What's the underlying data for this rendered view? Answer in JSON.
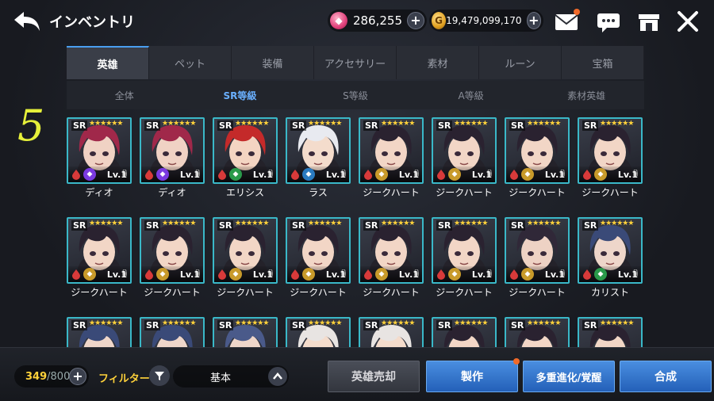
{
  "header": {
    "title": "インベントリ",
    "gems": "286,255",
    "gold": "19,479,099,170",
    "gold_symbol": "G"
  },
  "main_tabs": [
    {
      "label": "英雄",
      "active": true
    },
    {
      "label": "ペット",
      "active": false
    },
    {
      "label": "装備",
      "active": false
    },
    {
      "label": "アクセサリー",
      "active": false
    },
    {
      "label": "素材",
      "active": false
    },
    {
      "label": "ルーン",
      "active": false
    },
    {
      "label": "宝箱",
      "active": false
    }
  ],
  "sub_tabs": [
    {
      "label": "全体",
      "active": false
    },
    {
      "label": "SR等級",
      "active": true
    },
    {
      "label": "S等級",
      "active": false
    },
    {
      "label": "A等級",
      "active": false
    },
    {
      "label": "素材英雄",
      "active": false
    }
  ],
  "hand_mark": "5",
  "cards": [
    {
      "rank": "SR",
      "stars": "★★★★★★",
      "level": "Lv.1",
      "name": "ディオ",
      "hair": "#a0284a",
      "skin": "#f0d2c4",
      "class_color": "#7a3ae0",
      "class_icon": "purple-class-icon"
    },
    {
      "rank": "SR",
      "stars": "★★★★★★",
      "level": "Lv.1",
      "name": "ディオ",
      "hair": "#a0284a",
      "skin": "#f0d2c4",
      "class_color": "#7a3ae0",
      "class_icon": "purple-class-icon"
    },
    {
      "rank": "SR",
      "stars": "★★★★★★",
      "level": "Lv.1",
      "name": "エリシス",
      "hair": "#c42a2a",
      "skin": "#f4d4c2",
      "class_color": "#2a9a4a",
      "class_icon": "green-class-icon"
    },
    {
      "rank": "SR",
      "stars": "★★★★★★",
      "level": "Lv.1",
      "name": "ラス",
      "hair": "#e8eaf0",
      "skin": "#f4dccc",
      "class_color": "#2a7ac0",
      "class_icon": "blue-class-icon"
    },
    {
      "rank": "SR",
      "stars": "★★★★★★",
      "level": "Lv.1",
      "name": "ジークハート",
      "hair": "#2a2230",
      "skin": "#f2d6c6",
      "class_color": "#c89a2a",
      "class_icon": "gold-class-icon"
    },
    {
      "rank": "SR",
      "stars": "★★★★★★",
      "level": "Lv.1",
      "name": "ジークハート",
      "hair": "#2a2230",
      "skin": "#f2d6c6",
      "class_color": "#c89a2a",
      "class_icon": "gold-class-icon"
    },
    {
      "rank": "SR",
      "stars": "★★★★★★",
      "level": "Lv.1",
      "name": "ジークハート",
      "hair": "#2a2230",
      "skin": "#f2d6c6",
      "class_color": "#c89a2a",
      "class_icon": "gold-class-icon"
    },
    {
      "rank": "SR",
      "stars": "★★★★★★",
      "level": "Lv.1",
      "name": "ジークハート",
      "hair": "#2a2230",
      "skin": "#f2d6c6",
      "class_color": "#c89a2a",
      "class_icon": "gold-class-icon"
    },
    {
      "rank": "SR",
      "stars": "★★★★★★",
      "level": "Lv.1",
      "name": "ジークハート",
      "hair": "#2a2230",
      "skin": "#f2d6c6",
      "class_color": "#c89a2a",
      "class_icon": "gold-class-icon"
    },
    {
      "rank": "SR",
      "stars": "★★★★★★",
      "level": "Lv.1",
      "name": "ジークハート",
      "hair": "#2a2230",
      "skin": "#f2d6c6",
      "class_color": "#c89a2a",
      "class_icon": "gold-class-icon"
    },
    {
      "rank": "SR",
      "stars": "★★★★★★",
      "level": "Lv.1",
      "name": "ジークハート",
      "hair": "#2a2230",
      "skin": "#f2d6c6",
      "class_color": "#c89a2a",
      "class_icon": "gold-class-icon"
    },
    {
      "rank": "SR",
      "stars": "★★★★★★",
      "level": "Lv.1",
      "name": "ジークハート",
      "hair": "#2a2230",
      "skin": "#f2d6c6",
      "class_color": "#c89a2a",
      "class_icon": "gold-class-icon"
    },
    {
      "rank": "SR",
      "stars": "★★★★★★",
      "level": "Lv.1",
      "name": "ジークハート",
      "hair": "#2a2230",
      "skin": "#f2d6c6",
      "class_color": "#c89a2a",
      "class_icon": "gold-class-icon"
    },
    {
      "rank": "SR",
      "stars": "★★★★★★",
      "level": "Lv.1",
      "name": "ジークハート",
      "hair": "#2a2230",
      "skin": "#f2d6c6",
      "class_color": "#c89a2a",
      "class_icon": "gold-class-icon"
    },
    {
      "rank": "SR",
      "stars": "★★★★★★",
      "level": "Lv.1",
      "name": "ジークハート",
      "hair": "#302838",
      "skin": "#eed2c4",
      "class_color": "#c89a2a",
      "class_icon": "gold-class-icon"
    },
    {
      "rank": "SR",
      "stars": "★★★★★★",
      "level": "Lv.1",
      "name": "カリスト",
      "hair": "#3a4a78",
      "skin": "#eed6ca",
      "class_color": "#2a9a4a",
      "class_icon": "green-class-icon"
    },
    {
      "rank": "SR",
      "stars": "★★★★★★",
      "level": "",
      "name": "",
      "hair": "#3a4a78",
      "skin": "#eed6ca",
      "class_color": "#2a9a4a",
      "class_icon": "green-class-icon"
    },
    {
      "rank": "SR",
      "stars": "★★★★★★",
      "level": "",
      "name": "",
      "hair": "#3a4a78",
      "skin": "#eed6ca",
      "class_color": "#2a9a4a",
      "class_icon": "green-class-icon"
    },
    {
      "rank": "SR",
      "stars": "★★★★★★",
      "level": "",
      "name": "",
      "hair": "#4a5a8a",
      "skin": "#eed6ca",
      "class_color": "#2a9a4a",
      "class_icon": "green-class-icon"
    },
    {
      "rank": "SR",
      "stars": "★★★★★★",
      "level": "",
      "name": "",
      "hair": "#e8e4e2",
      "skin": "#f4dccc",
      "class_color": "#2a7ac0",
      "class_icon": "blue-class-icon"
    },
    {
      "rank": "SR",
      "stars": "★★★★★★",
      "level": "",
      "name": "",
      "hair": "#e8e4e2",
      "skin": "#f4dccc",
      "class_color": "#2a7ac0",
      "class_icon": "blue-class-icon"
    },
    {
      "rank": "SR",
      "stars": "★★★★★★",
      "level": "",
      "name": "",
      "hair": "#2a2230",
      "skin": "#f2d6c6",
      "class_color": "#c89a2a",
      "class_icon": "gold-class-icon"
    },
    {
      "rank": "SR",
      "stars": "★★★★★★",
      "level": "",
      "name": "",
      "hair": "#2a2230",
      "skin": "#f2d6c6",
      "class_color": "#c89a2a",
      "class_icon": "gold-class-icon"
    },
    {
      "rank": "SR",
      "stars": "★★★★★★",
      "level": "",
      "name": "",
      "hair": "#2a2230",
      "skin": "#f2d6c6",
      "class_color": "#c89a2a",
      "class_icon": "gold-class-icon"
    }
  ],
  "footer": {
    "count_current": "349",
    "count_max": "/800",
    "filter_label": "フィルター",
    "sort_value": "基本",
    "sell_label": "英雄売却",
    "craft_label": "製作",
    "evolve_label": "多重進化/覚醒",
    "synth_label": "合成"
  },
  "colors": {
    "accent_blue": "#4a8ee0",
    "card_border": "#3ab8c8",
    "star_yellow": "#ffd23a",
    "notification": "#f06a2a"
  }
}
